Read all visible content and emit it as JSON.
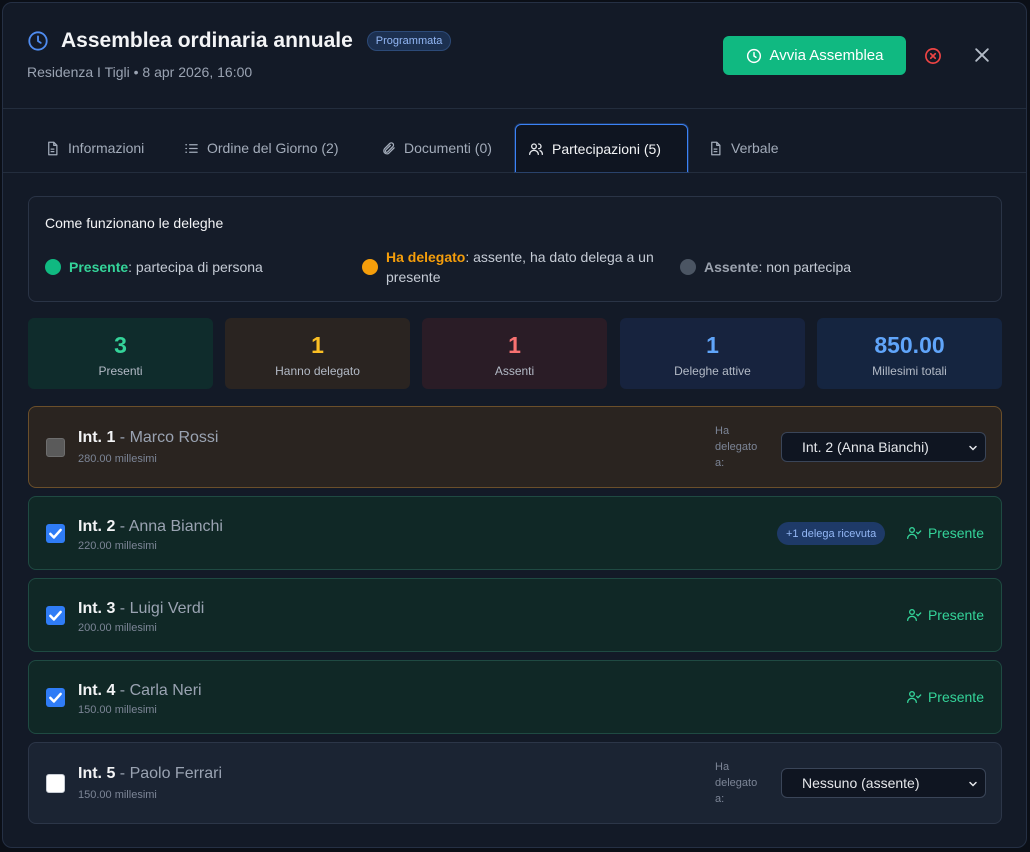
{
  "header": {
    "title": "Assemblea ordinaria annuale",
    "status": "Programmata",
    "subtitle": "Residenza I Tigli • 8 apr 2026, 16:00",
    "start_button": "Avvia Assemblea"
  },
  "tabs": [
    {
      "label": "Informazioni",
      "icon": "document-icon"
    },
    {
      "label": "Ordine del Giorno (2)",
      "icon": "list-icon"
    },
    {
      "label": "Documenti (0)",
      "icon": "paperclip-icon"
    },
    {
      "label": "Partecipazioni (5)",
      "icon": "users-icon",
      "active": true
    },
    {
      "label": "Verbale",
      "icon": "document-icon"
    }
  ],
  "info": {
    "title": "Come funzionano le deleghe",
    "present_label": "Presente",
    "present_desc": ": partecipa di persona",
    "delegated_label": "Ha delegato",
    "delegated_desc": ": assente, ha dato delega a un presente",
    "absent_label": "Assente",
    "absent_desc": ": non partecipa"
  },
  "stats": [
    {
      "value": "3",
      "label": "Presenti"
    },
    {
      "value": "1",
      "label": "Hanno delegato"
    },
    {
      "value": "1",
      "label": "Assenti"
    },
    {
      "value": "1",
      "label": "Deleghe attive"
    },
    {
      "value": "850.00",
      "label": "Millesimi totali"
    }
  ],
  "participants": [
    {
      "code": "Int. 1",
      "sep": " - ",
      "name": "Marco Rossi",
      "millesimi": "280.00 millesimi",
      "state": "delegated",
      "delegate_label": "Ha delegato a:",
      "delegate_value": "Int. 2 (Anna Bianchi)"
    },
    {
      "code": "Int. 2",
      "sep": " - ",
      "name": "Anna Bianchi",
      "millesimi": "220.00 millesimi",
      "state": "present",
      "badge": "+1 delega ricevuta",
      "present_label": "Presente"
    },
    {
      "code": "Int. 3",
      "sep": " - ",
      "name": "Luigi Verdi",
      "millesimi": "200.00 millesimi",
      "state": "present",
      "present_label": "Presente"
    },
    {
      "code": "Int. 4",
      "sep": " - ",
      "name": "Carla Neri",
      "millesimi": "150.00 millesimi",
      "state": "present",
      "present_label": "Presente"
    },
    {
      "code": "Int. 5",
      "sep": " - ",
      "name": "Paolo Ferrari",
      "millesimi": "150.00 millesimi",
      "state": "absent",
      "delegate_label": "Ha delegato a:",
      "delegate_value": "Nessuno (assente)"
    }
  ],
  "colors": {
    "present": "#10b981",
    "delegated": "#f59e0b",
    "absent": "#4b5563",
    "accent": "#3b82f6"
  }
}
